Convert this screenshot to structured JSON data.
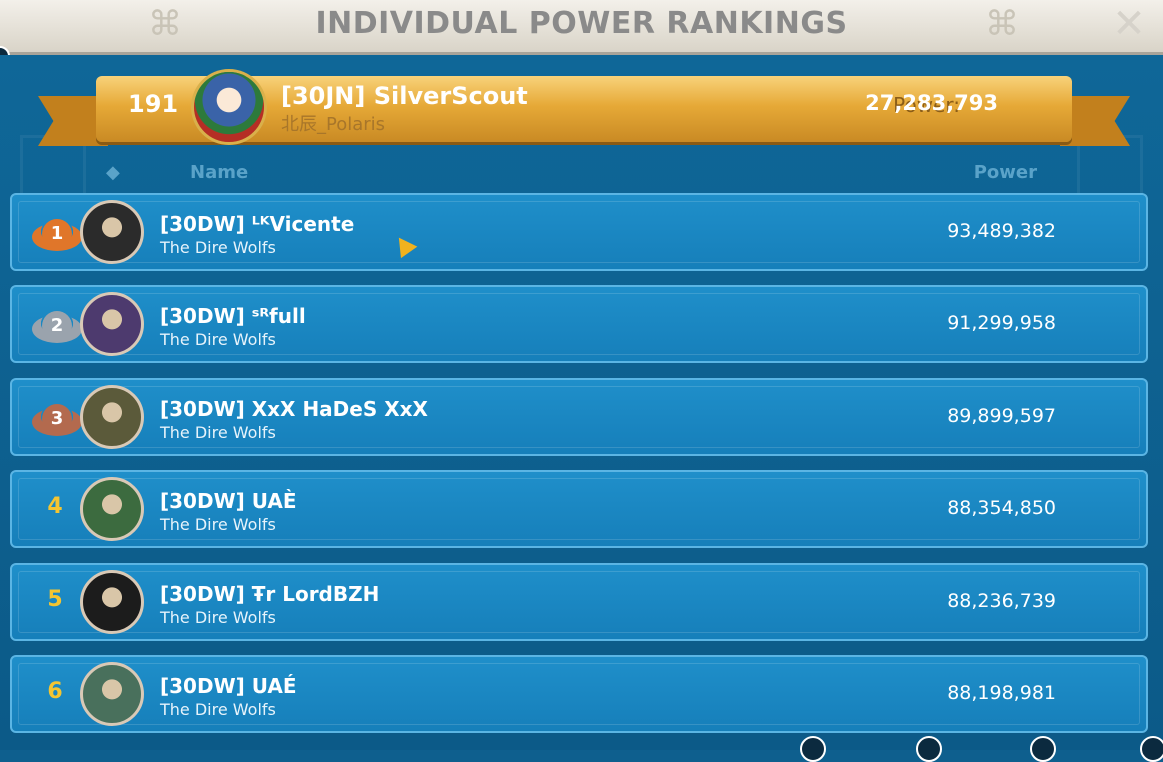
{
  "window": {
    "title": "INDIVIDUAL POWER RANKINGS",
    "close_icon": "close-icon"
  },
  "self": {
    "rank": "191",
    "name": "[30JN] SilverScout",
    "subtitle": "北辰_Polaris",
    "power_label": "Power:",
    "power": "27,283,793"
  },
  "headers": {
    "name": "Name",
    "power": "Power"
  },
  "rows": [
    {
      "rank": "1",
      "name": "[30DW] ᴸᴷVicente",
      "alliance": "The Dire Wolfs",
      "power": "93,489,382",
      "badge_color": "#e0762a",
      "avatar_color": "#2b2b2b"
    },
    {
      "rank": "2",
      "name": "[30DW] ˢᴿfull",
      "alliance": "The Dire Wolfs",
      "power": "91,299,958",
      "badge_color": "#9aa3ad",
      "avatar_color": "#4d3a6e"
    },
    {
      "rank": "3",
      "name": "[30DW] XxX HaDeS XxX",
      "alliance": "The Dire Wolfs",
      "power": "89,899,597",
      "badge_color": "#b36a4e",
      "avatar_color": "#5b5a3a"
    },
    {
      "rank": "4",
      "name": "[30DW] UAÈ",
      "alliance": "The Dire Wolfs",
      "power": "88,354,850",
      "badge_color": "",
      "avatar_color": "#3c6b3f"
    },
    {
      "rank": "5",
      "name": "[30DW] Ŧr LordBZH",
      "alliance": "The Dire Wolfs",
      "power": "88,236,739",
      "badge_color": "",
      "avatar_color": "#1c1c1c"
    },
    {
      "rank": "6",
      "name": "[30DW] UAÉ",
      "alliance": "The Dire Wolfs",
      "power": "88,198,981",
      "badge_color": "",
      "avatar_color": "#49705c"
    }
  ]
}
